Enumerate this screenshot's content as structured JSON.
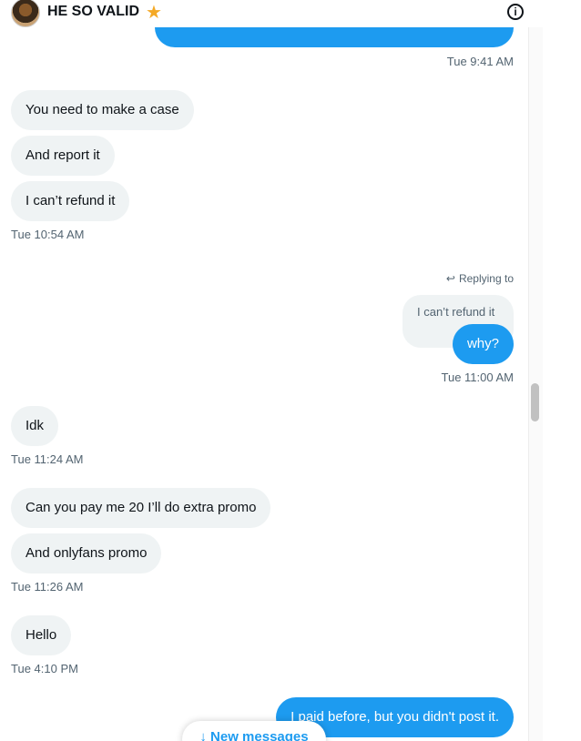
{
  "header": {
    "title": "HE SO VALID",
    "star": "★",
    "info": "i"
  },
  "messages": {
    "ts1": "Tue 9:41 AM",
    "m1": "You need to make a case",
    "m2": "And report it",
    "m3": "I can’t refund it",
    "ts2": "Tue 10:54 AM",
    "replying_to": "Replying to",
    "quoted": "I can’t refund it",
    "m4": "why?",
    "ts3": "Tue 11:00 AM",
    "m5": "Idk",
    "ts4": "Tue 11:24 AM",
    "m6": "Can you pay me 20 I’ll do extra promo",
    "m7": "And onlyfans promo",
    "ts5": "Tue 11:26 AM",
    "m8": "Hello",
    "ts6": "Tue 4:10 PM",
    "m9": "I paid before, but you didn't post it."
  },
  "new_messages": "↓ New messages",
  "colors": {
    "accent": "#1d9bf0",
    "incoming_bubble": "#eff3f4",
    "muted": "#536471"
  }
}
